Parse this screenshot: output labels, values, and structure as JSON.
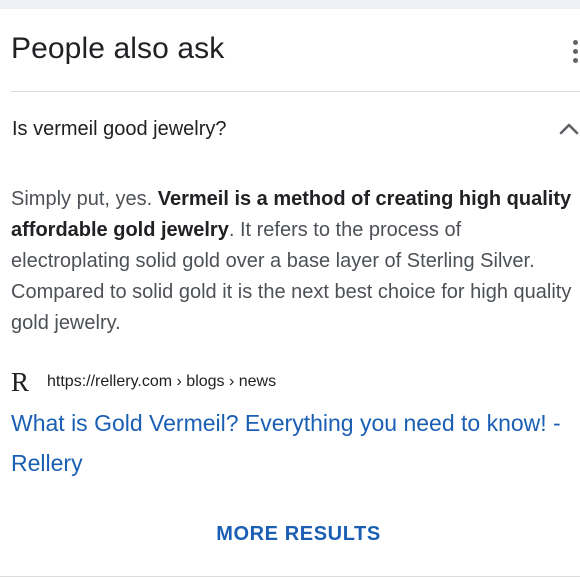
{
  "header": {
    "title": "People also ask"
  },
  "question": {
    "text": "Is vermeil good jewelry?",
    "expanded": true
  },
  "answer": {
    "intro": "Simply put, yes. ",
    "highlight": "Vermeil is a method of creating high quality affordable gold jewelry",
    "rest": ". It refers to the process of electroplating solid gold over a base layer of Sterling Silver. Compared to solid gold it is the next best choice for high quality gold jewelry."
  },
  "source": {
    "favicon_letter": "R",
    "url": "https://rellery.com › blogs › news",
    "title": "What is Gold Vermeil? Everything you need to know! - Rellery"
  },
  "footer": {
    "more_results_label": "MORE RESULTS"
  },
  "colors": {
    "link": "#1a5fb4",
    "text_primary": "#202124",
    "text_secondary": "#4d5156",
    "divider": "#dadce0"
  }
}
